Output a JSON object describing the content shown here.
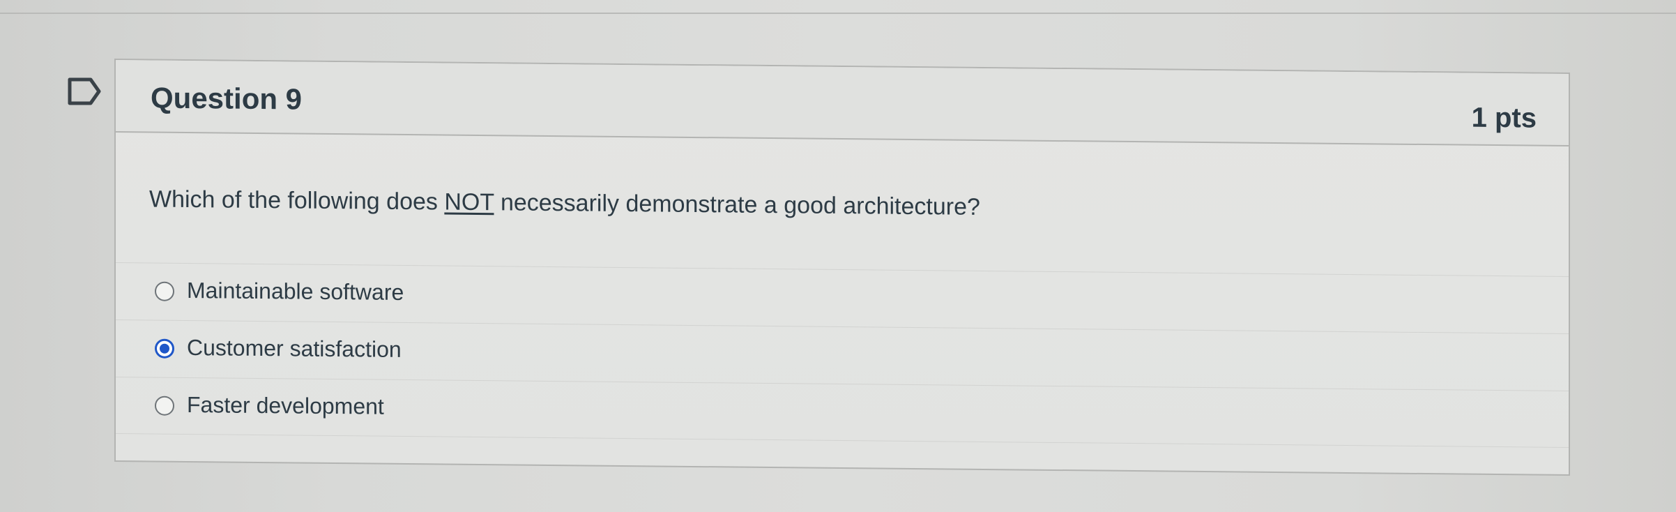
{
  "question": {
    "title": "Question 9",
    "points": "1 pts",
    "text_before": "Which of the following does ",
    "text_emphasis": "NOT",
    "text_after": " necessarily demonstrate a good architecture?",
    "flag_icon": "flag-outline-icon",
    "answers": [
      {
        "label": "Maintainable software",
        "selected": false
      },
      {
        "label": "Customer satisfaction",
        "selected": true
      },
      {
        "label": "Faster development",
        "selected": false
      }
    ]
  },
  "colors": {
    "selected_radio": "#1f57c8",
    "text": "#2d3b45",
    "border": "#b3b4b2"
  }
}
